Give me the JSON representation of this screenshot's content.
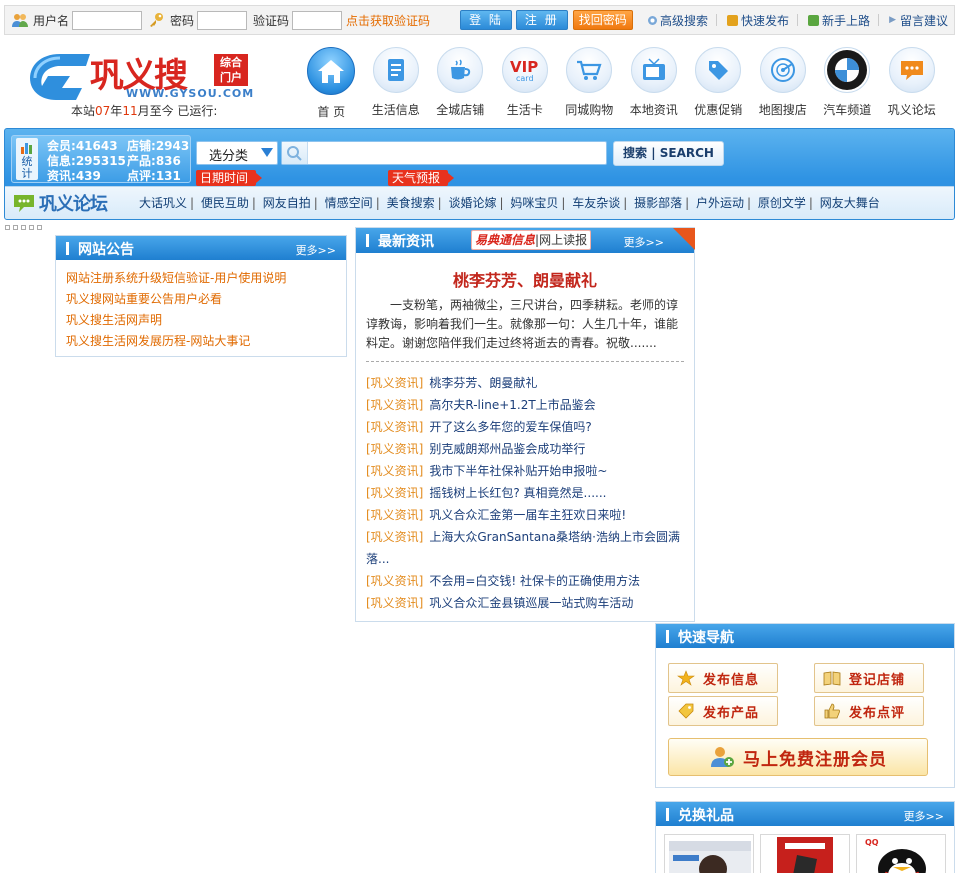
{
  "login": {
    "username_label": "用户名",
    "password_label": "密码",
    "captcha_label": "验证码",
    "get_code": "点击获取验证码",
    "login_button": "登 陆",
    "register_button": "注 册",
    "forgot_button": "找回密码"
  },
  "toplinks": [
    {
      "label": "高级搜索",
      "icon": "gear-icon"
    },
    {
      "label": "快速发布",
      "icon": "play-icon"
    },
    {
      "label": "新手上路",
      "icon": "help-icon"
    },
    {
      "label": "留言建议",
      "icon": "arrow-icon"
    }
  ],
  "brand": {
    "name": "巩义搜",
    "badge_line1": "综合",
    "badge_line2": "门户",
    "url": "WWW.GYSOU.COM"
  },
  "runtime": {
    "prefix": "本站",
    "month": "07",
    "month_unit": "年",
    "day": "11",
    "suffix": "月至今 已运行:"
  },
  "nav": [
    {
      "label": "首 页",
      "icon": "home-icon"
    },
    {
      "label": "生活信息",
      "icon": "document-icon"
    },
    {
      "label": "全城店铺",
      "icon": "cup-icon"
    },
    {
      "label": "生活卡",
      "icon": "vip-card-icon"
    },
    {
      "label": "同城购物",
      "icon": "cart-icon"
    },
    {
      "label": "本地资讯",
      "icon": "tv-icon"
    },
    {
      "label": "优惠促销",
      "icon": "tag-icon"
    },
    {
      "label": "地图搜店",
      "icon": "radar-icon"
    },
    {
      "label": "汽车频道",
      "icon": "bmw-icon"
    },
    {
      "label": "巩义论坛",
      "icon": "chat-icon"
    }
  ],
  "stats": {
    "icon_label": "统计",
    "members_label": "会员:",
    "members": "41643",
    "shops_label": "店铺:",
    "shops": "2943",
    "info_label": "信息:",
    "info": "295315",
    "products_label": "产品:",
    "products": "836",
    "news_label": "资讯:",
    "news": "439",
    "reviews_label": "点评:",
    "reviews": "131"
  },
  "search": {
    "category": "选分类",
    "button": "搜索 | SEARCH",
    "tag_date": "日期时间",
    "tag_weather": "天气预报"
  },
  "forum": {
    "logo": "巩义论坛",
    "links": [
      "大话巩义",
      "便民互助",
      "网友自拍",
      "情感空间",
      "美食搜索",
      "谈婚论嫁",
      "妈咪宝贝",
      "车友杂谈",
      "摄影部落",
      "户外运动",
      "原创文学",
      "网友大舞台"
    ]
  },
  "notice": {
    "title": "网站公告",
    "more": "更多>>",
    "items": [
      "网站注册系统升级短信验证-用户使用说明",
      "巩义搜网站重要公告用户必看",
      "巩义搜生活网声明",
      "巩义搜生活网发展历程-网站大事记"
    ]
  },
  "news": {
    "title": "最新资讯",
    "paper_brand": "易典通信息",
    "paper_text": "网上读报",
    "more": "更多>>",
    "headline": "桃李芬芳、朗曼献礼",
    "summary": "一支粉笔，两袖微尘，三尺讲台，四季耕耘。老师的谆谆教诲，影响着我们一生。就像那一句：人生几十年，谁能料定。谢谢您陪伴我们走过终将逝去的青春。祝敬.......",
    "category": "[巩义资讯]",
    "items": [
      "桃李芬芳、朗曼献礼",
      "高尔夫R-line+1.2T上市品鉴会",
      "开了这么多年您的爱车保值吗?",
      "别克威朗郑州品鉴会成功举行",
      "我市下半年社保补贴开始申报啦~",
      "摇钱树上长红包? 真相竟然是......",
      "巩义合众汇金第一届车主狂欢日来啦!",
      "上海大众GranSantana桑塔纳·浩纳上市会圆满落...",
      "不会用=白交钱! 社保卡的正确使用方法",
      "巩义合众汇金县镇巡展一站式购车活动"
    ]
  },
  "quicknav": {
    "title": "快速导航",
    "post_info": "发布信息",
    "register_shop": "登记店铺",
    "post_product": "发布产品",
    "post_review": "发布点评",
    "register_member": "马上免费注册会员"
  },
  "gifts": {
    "title": "兑换礼品",
    "more": "更多>>"
  }
}
